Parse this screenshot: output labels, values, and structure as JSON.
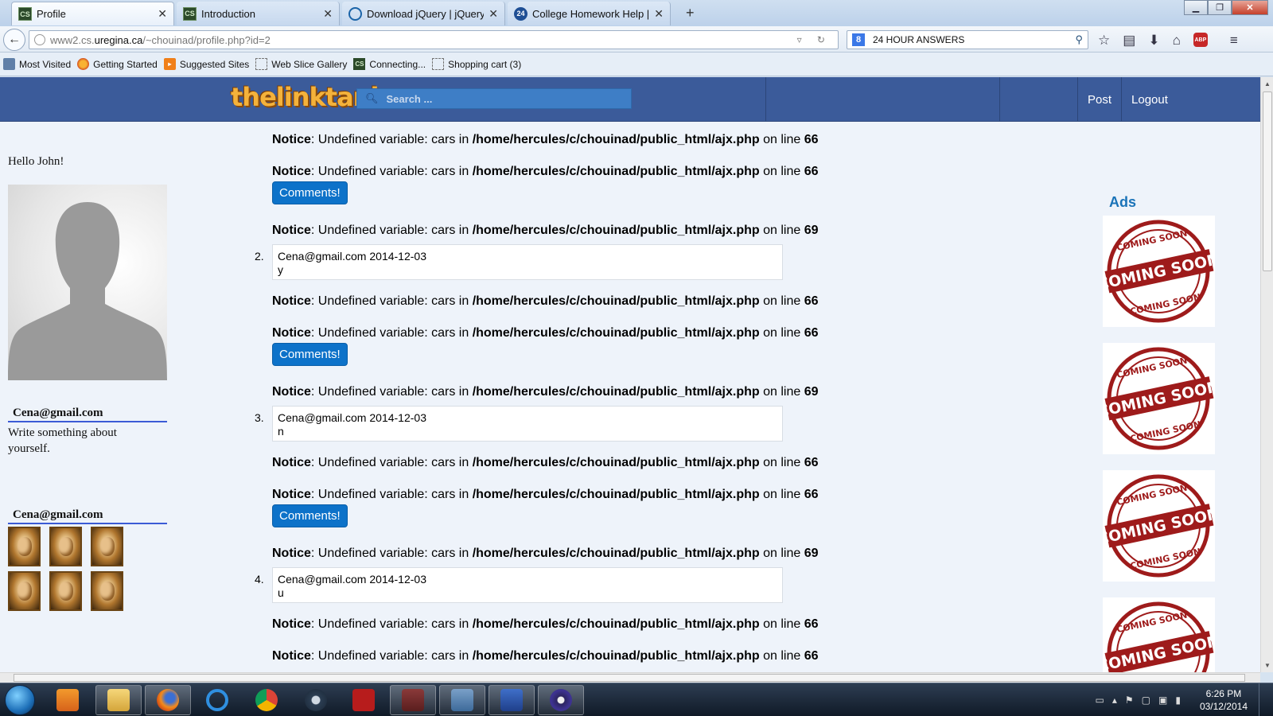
{
  "browser": {
    "tabs": [
      {
        "label": "Profile",
        "favicon": "CS",
        "active": true
      },
      {
        "label": "Introduction",
        "favicon": "CS",
        "active": false
      },
      {
        "label": "Download jQuery | jQuery",
        "favicon": "jquery",
        "active": false
      },
      {
        "label": "College Homework Help | ...",
        "favicon": "24",
        "active": false
      }
    ],
    "new_tab": "+",
    "url_domain": "www2.cs.",
    "url_host": "uregina.ca",
    "url_path": "/~chouinad/profile.php?id=2",
    "search_value": "24 HOUR ANSWERS",
    "search_engine_glyph": "8",
    "bookmarks": [
      {
        "label": "Most Visited",
        "icon": "book-icon"
      },
      {
        "label": "Getting Started",
        "icon": "firefox-icon"
      },
      {
        "label": "Suggested Sites",
        "icon": "suggested-icon"
      },
      {
        "label": "Web Slice Gallery",
        "icon": "webslice-icon"
      },
      {
        "label": "Connecting...",
        "icon": "cs-icon"
      },
      {
        "label": "Shopping cart (3)",
        "icon": "webslice-icon"
      }
    ],
    "abp_label": "ABP"
  },
  "site": {
    "logo": "thelinktank",
    "search_placeholder": "Search ...",
    "nav": {
      "post": "Post",
      "logout": "Logout"
    },
    "brand_color": "#3b5b9a"
  },
  "sidebar": {
    "greeting": "Hello John!",
    "user_email": "Cena@gmail.com",
    "about_text": "Write something about yourself.",
    "friends_email": "Cena@gmail.com"
  },
  "notice": {
    "word": "Notice",
    "text": ": Undefined variable: cars in ",
    "path": "/home/hercules/c/chouinad/public_html/ajx.php",
    "on_line": " on line "
  },
  "feed": {
    "comments_label": "Comments!",
    "lines": [
      "66",
      "66",
      "69",
      "66",
      "66",
      "69",
      "66",
      "66",
      "69",
      "66",
      "66"
    ],
    "comments": [
      {
        "number": "2.",
        "author": "Cena@gmail.com",
        "date": "2014-12-03",
        "text": "y"
      },
      {
        "number": "3.",
        "author": "Cena@gmail.com",
        "date": "2014-12-03",
        "text": "n"
      },
      {
        "number": "4.",
        "author": "Cena@gmail.com",
        "date": "2014-12-03",
        "text": "u"
      }
    ]
  },
  "ads": {
    "title": "Ads",
    "stamp_top": "COMING SOON",
    "stamp_main": "COMING SOON",
    "stamp_bottom": "COMING SOON"
  },
  "taskbar": {
    "time": "6:26 PM",
    "date": "03/12/2014"
  }
}
